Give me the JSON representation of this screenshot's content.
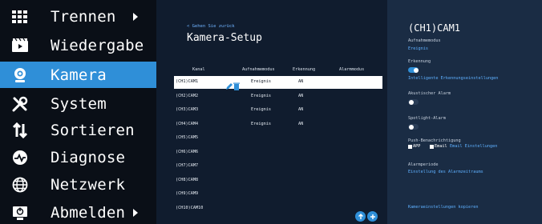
{
  "sidebar": {
    "items": [
      {
        "label": "Trennen",
        "icon": "grid-icon",
        "has_arrow": true
      },
      {
        "label": "Wiedergabe",
        "icon": "film-icon",
        "has_arrow": false
      },
      {
        "label": "Kamera",
        "icon": "camera-icon",
        "has_arrow": false,
        "active": true
      },
      {
        "label": "System",
        "icon": "tools-icon",
        "has_arrow": false
      },
      {
        "label": "Sortieren",
        "icon": "sort-icon",
        "has_arrow": false
      },
      {
        "label": "Diagnose",
        "icon": "pulse-icon",
        "has_arrow": false
      },
      {
        "label": "Netzwerk",
        "icon": "globe-icon",
        "has_arrow": false
      },
      {
        "label": "Abmelden",
        "icon": "logout-icon",
        "has_arrow": true
      }
    ]
  },
  "main": {
    "back_link": "< Gehen Sie zurück",
    "title": "Kamera-Setup",
    "columns": [
      "Kanal",
      "Aufnahmemodus",
      "Erkennung",
      "Alarmmodus"
    ],
    "rows": [
      {
        "channel": "(CH1)CAM1",
        "mode": "Ereignis",
        "detection": "AN",
        "alarm": "",
        "selected": true
      },
      {
        "channel": "(CH2)CAM2",
        "mode": "Ereignis",
        "detection": "AN",
        "alarm": ""
      },
      {
        "channel": "(CH3)CAM3",
        "mode": "Ereignis",
        "detection": "AN",
        "alarm": ""
      },
      {
        "channel": "(CH4)CAM4",
        "mode": "Ereignis",
        "detection": "AN",
        "alarm": ""
      },
      {
        "channel": "(CH5)CAM5",
        "mode": "",
        "detection": "",
        "alarm": ""
      },
      {
        "channel": "(CH6)CAM6",
        "mode": "",
        "detection": "",
        "alarm": ""
      },
      {
        "channel": "(CH7)CAM7",
        "mode": "",
        "detection": "",
        "alarm": ""
      },
      {
        "channel": "(CH8)CAM8",
        "mode": "",
        "detection": "",
        "alarm": ""
      },
      {
        "channel": "(CH9)CAM9",
        "mode": "",
        "detection": "",
        "alarm": ""
      },
      {
        "channel": "(CH10)CAM10",
        "mode": "",
        "detection": "",
        "alarm": ""
      }
    ]
  },
  "panel": {
    "title": "(CH1)CAM1",
    "recording_label": "Aufnahmemodus",
    "recording_value": "Ereignis",
    "detection_label": "Erkennung",
    "detection_on": true,
    "detection_link": "Intelligente Erkennungseinstellungen",
    "acoustic_label": "Akustischer Alarm",
    "acoustic_on": false,
    "spotlight_label": "Spotlight-Alarm",
    "spotlight_on": false,
    "push_label": "Push-Benachrichtigung",
    "push_app": "APP",
    "push_email": "Email",
    "email_link": "Email Einstellungen",
    "alarm_period_label": "Alarmperiode",
    "alarm_period_link": "Einstellung des Alarmzeitraums",
    "copy_link": "Kameraeinstellungen kopieren"
  },
  "colors": {
    "accent": "#2f8fd8",
    "link": "#5eb0ff",
    "sidebar_bg": "#0a0f17",
    "main_bg": "#101c2e",
    "panel_bg": "#1a2c44"
  }
}
